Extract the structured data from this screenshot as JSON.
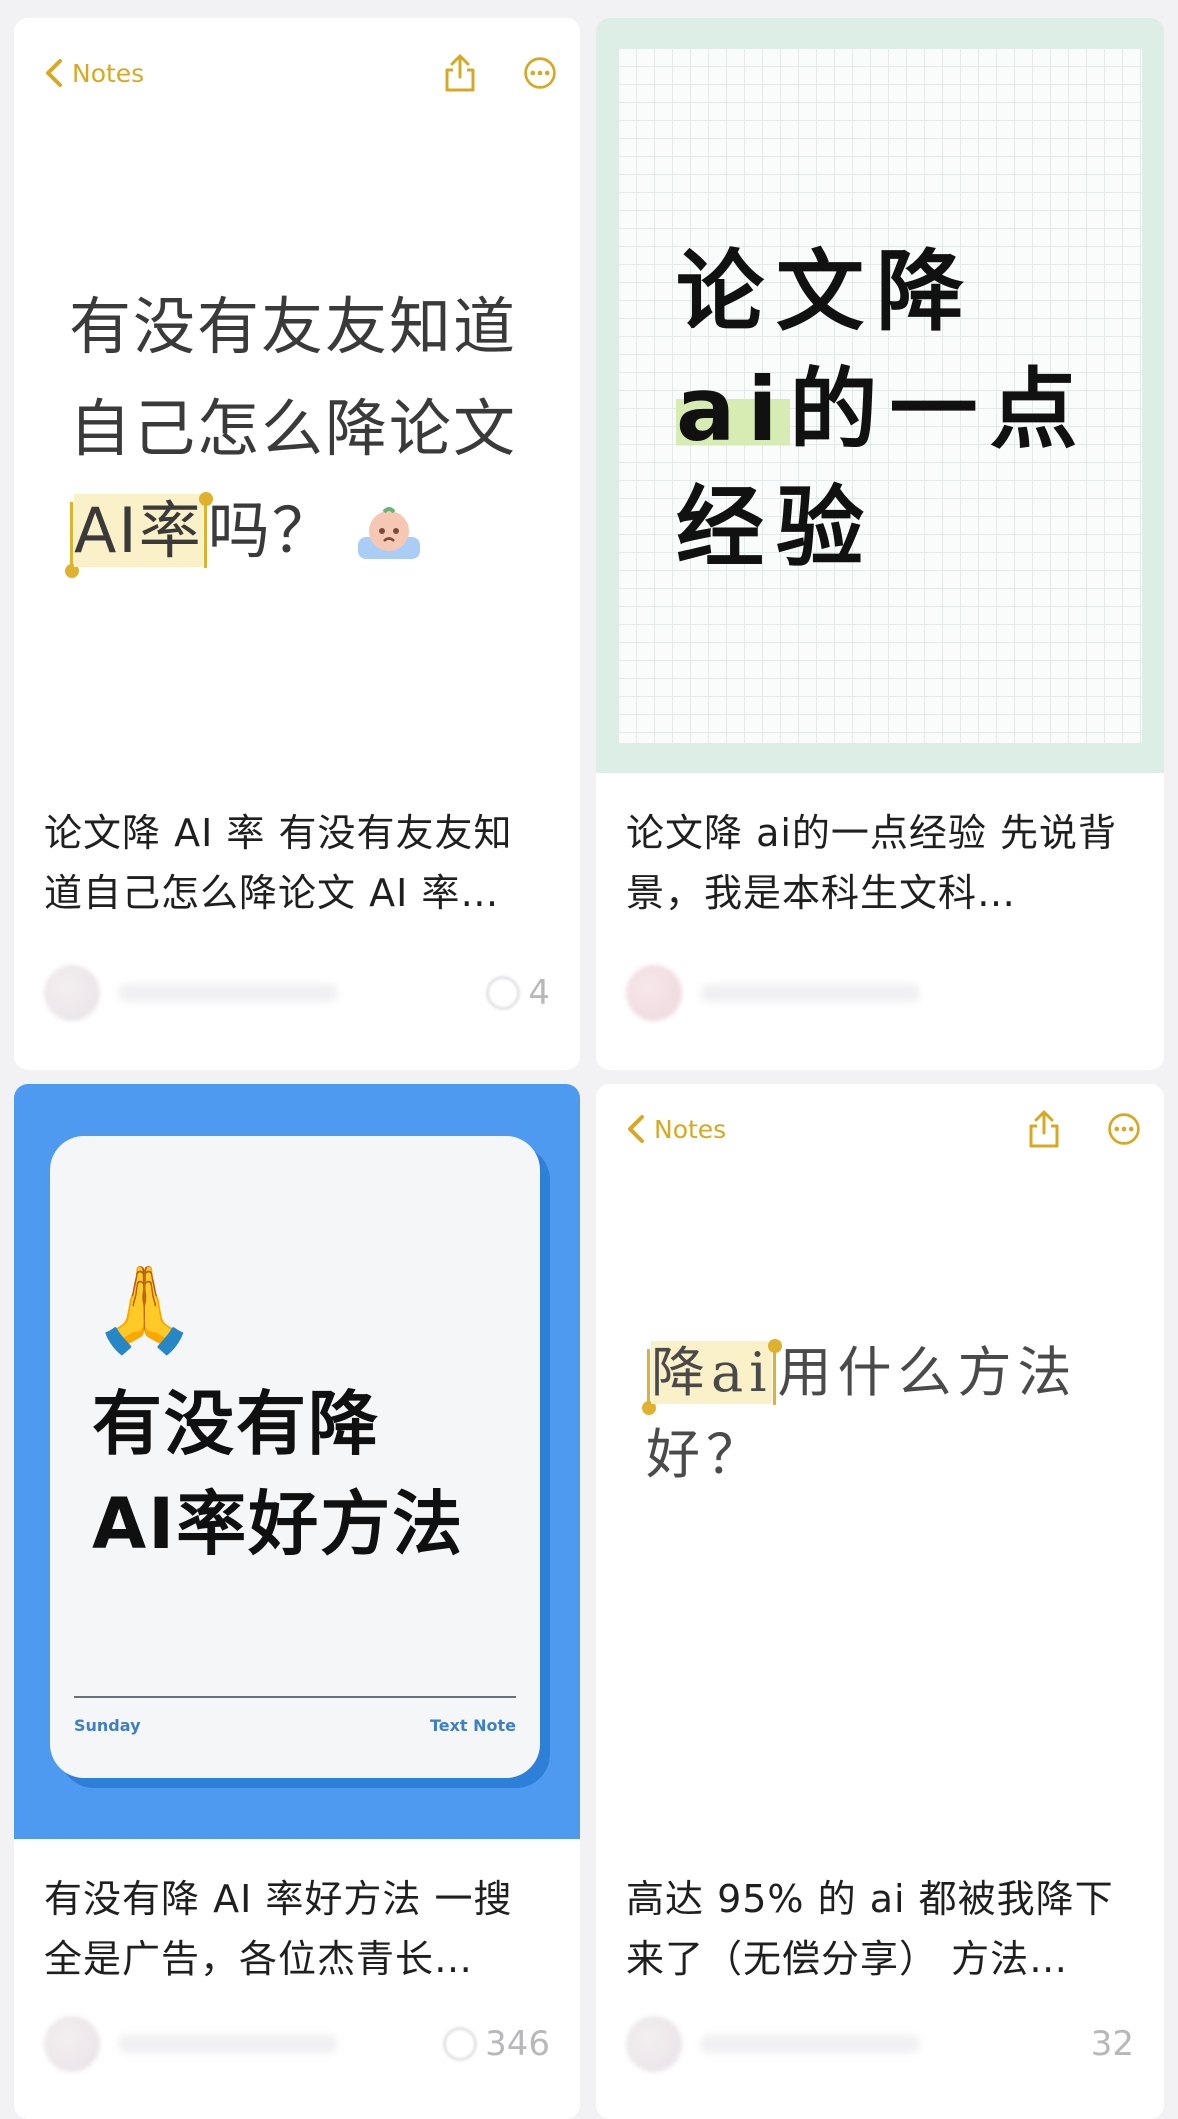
{
  "cards": [
    {
      "notes_back_label": "Notes",
      "thumb_lines": [
        "有没有友友知道",
        "自己怎么降论文"
      ],
      "thumb_highlight": "AI率",
      "thumb_tail": "吗？",
      "caption": "论文降 AI 率 有没有友友知道自己怎么降论文 AI 率…",
      "likes": "4"
    },
    {
      "thumb_line1": "论文降",
      "thumb_highlight": "ai",
      "thumb_line2_rest": "的一点",
      "thumb_line3": "经验",
      "caption": "论文降 ai的一点经验 先说背景，我是本科生文科…",
      "likes": ""
    },
    {
      "thumb_emoji": "🙏",
      "thumb_title_line1": "有没有降",
      "thumb_title_line2": "AI率好方法",
      "phone_left": "Sunday",
      "phone_right": "Text Note",
      "caption": "有没有降 AI 率好方法 一搜全是广告，各位杰青长…",
      "likes": "346"
    },
    {
      "notes_back_label": "Notes",
      "thumb_highlight": "降ai",
      "thumb_line1_rest": "用什么方法",
      "thumb_line2": "好？",
      "caption": "高达 95% 的 ai 都被我降下来了（无偿分享） 方法…",
      "likes": "32"
    }
  ],
  "colors": {
    "notes_accent": "#d9a823",
    "highlight_yellow": "#fbf1c8",
    "highlight_green": "#d6ecb3",
    "card3_blue": "#4d9af0"
  }
}
